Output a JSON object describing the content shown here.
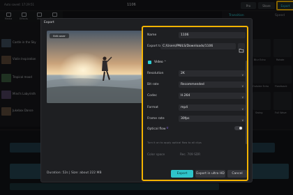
{
  "app": {
    "autosave": "Auto saved: 17:29:51",
    "doc_title": "1106",
    "header_buttons": [
      "Pro",
      "Share",
      "Export"
    ]
  },
  "toolbar": {
    "items": [
      "Media",
      "Effects",
      "Text",
      "Stickers"
    ]
  },
  "left_panel": {
    "items": [
      "Castle in the Sky",
      "Violin Inspiration",
      "Tropical mood",
      "Mind's Labyrinth",
      "Jukebox Dance"
    ]
  },
  "right_panel": {
    "tabs": [
      "Transition",
      "Speed"
    ],
    "cards": [
      "Blur Echo",
      "Rotate",
      "Outside Echo",
      "Flashback",
      "Swing",
      "Full Wave"
    ]
  },
  "modal": {
    "title": "Export",
    "edit_cover": "Edit cover",
    "footer_info": "Duration: 52s | Size: about 222 MB"
  },
  "settings": {
    "name_label": "Name",
    "name_value": "1106",
    "export_to_label": "Export to",
    "export_to_value": "C:/Users/PNILS/Downloads/1106",
    "video_section": "Video",
    "fields": [
      {
        "label": "Resolution",
        "value": "2K"
      },
      {
        "label": "Bit rate",
        "value": "Recommended"
      },
      {
        "label": "Codec",
        "value": "H.264"
      },
      {
        "label": "Format",
        "value": "mp4"
      },
      {
        "label": "Frame rate",
        "value": "30fps"
      }
    ],
    "optical_flow_label": "Optical flow",
    "optical_flow_hint": "Turn it on to apply optical flow to all clips",
    "color_space_label": "Color space",
    "color_space_value": "Rec. 709 SDR",
    "buttons": {
      "export": "Export",
      "export_ultra": "Export in ultra HD",
      "cancel": "Cancel"
    }
  },
  "colors": {
    "accent": "#2fc4ca",
    "highlight": "#f5b400",
    "panel": "#1e1f22"
  }
}
